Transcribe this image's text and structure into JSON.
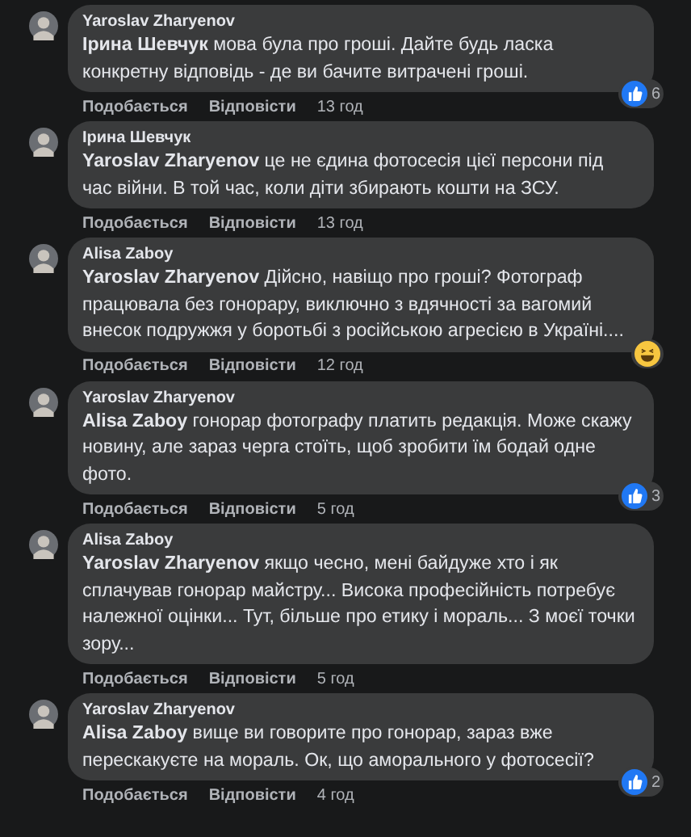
{
  "comments": [
    {
      "author": "Yaroslav Zharyenov",
      "text": "**Ірина Шевчук** мова була про гроші. Дайте будь ласка конкретну відповідь - де ви бачите витрачені гроші.",
      "like": "Подобається",
      "reply": "Відповісти",
      "time": "13 год",
      "reaction": {
        "kind": "like",
        "count": "6"
      }
    },
    {
      "author": "Ірина Шевчук",
      "text": "**Yaroslav Zharyenov** це не єдина фотосесія цієї персони під час війни. В той час, коли діти збирають кошти на ЗСУ.",
      "like": "Подобається",
      "reply": "Відповісти",
      "time": "13 год"
    },
    {
      "author": "Alisa Zaboy",
      "text": "**Yaroslav Zharyenov** Дійсно, навіщо про гроші? Фотограф працювала без гонорару, виключно з вдячності за вагомий внесок подружжя у боротьбі з російською агресією в Україні....",
      "like": "Подобається",
      "reply": "Відповісти",
      "time": "12 год",
      "reaction": {
        "kind": "haha"
      }
    },
    {
      "author": "Yaroslav Zharyenov",
      "text": "**Alisa Zaboy** гонорар фотографу платить редакція. Може скажу новину, але зараз черга стоїть, щоб зробити їм бодай одне фото.",
      "like": "Подобається",
      "reply": "Відповісти",
      "time": "5 год",
      "reaction": {
        "kind": "like",
        "count": "3"
      }
    },
    {
      "author": "Alisa Zaboy",
      "text": "**Yaroslav Zharyenov** якщо чесно, мені байдуже хто і як сплачував гонорар майстру... Висока професійність потребує належної оцінки... Тут, більше про етику і мораль... З моєї точки зору...",
      "like": "Подобається",
      "reply": "Відповісти",
      "time": "5 год"
    },
    {
      "author": "Yaroslav Zharyenov",
      "text": "**Alisa Zaboy** вище ви говорите про гонорар, зараз вже перескакуєте на мораль. Ок, що аморального у фотосесії?",
      "like": "Подобається",
      "reply": "Відповісти",
      "time": "4 год",
      "reaction": {
        "kind": "like",
        "count": "2"
      }
    }
  ]
}
